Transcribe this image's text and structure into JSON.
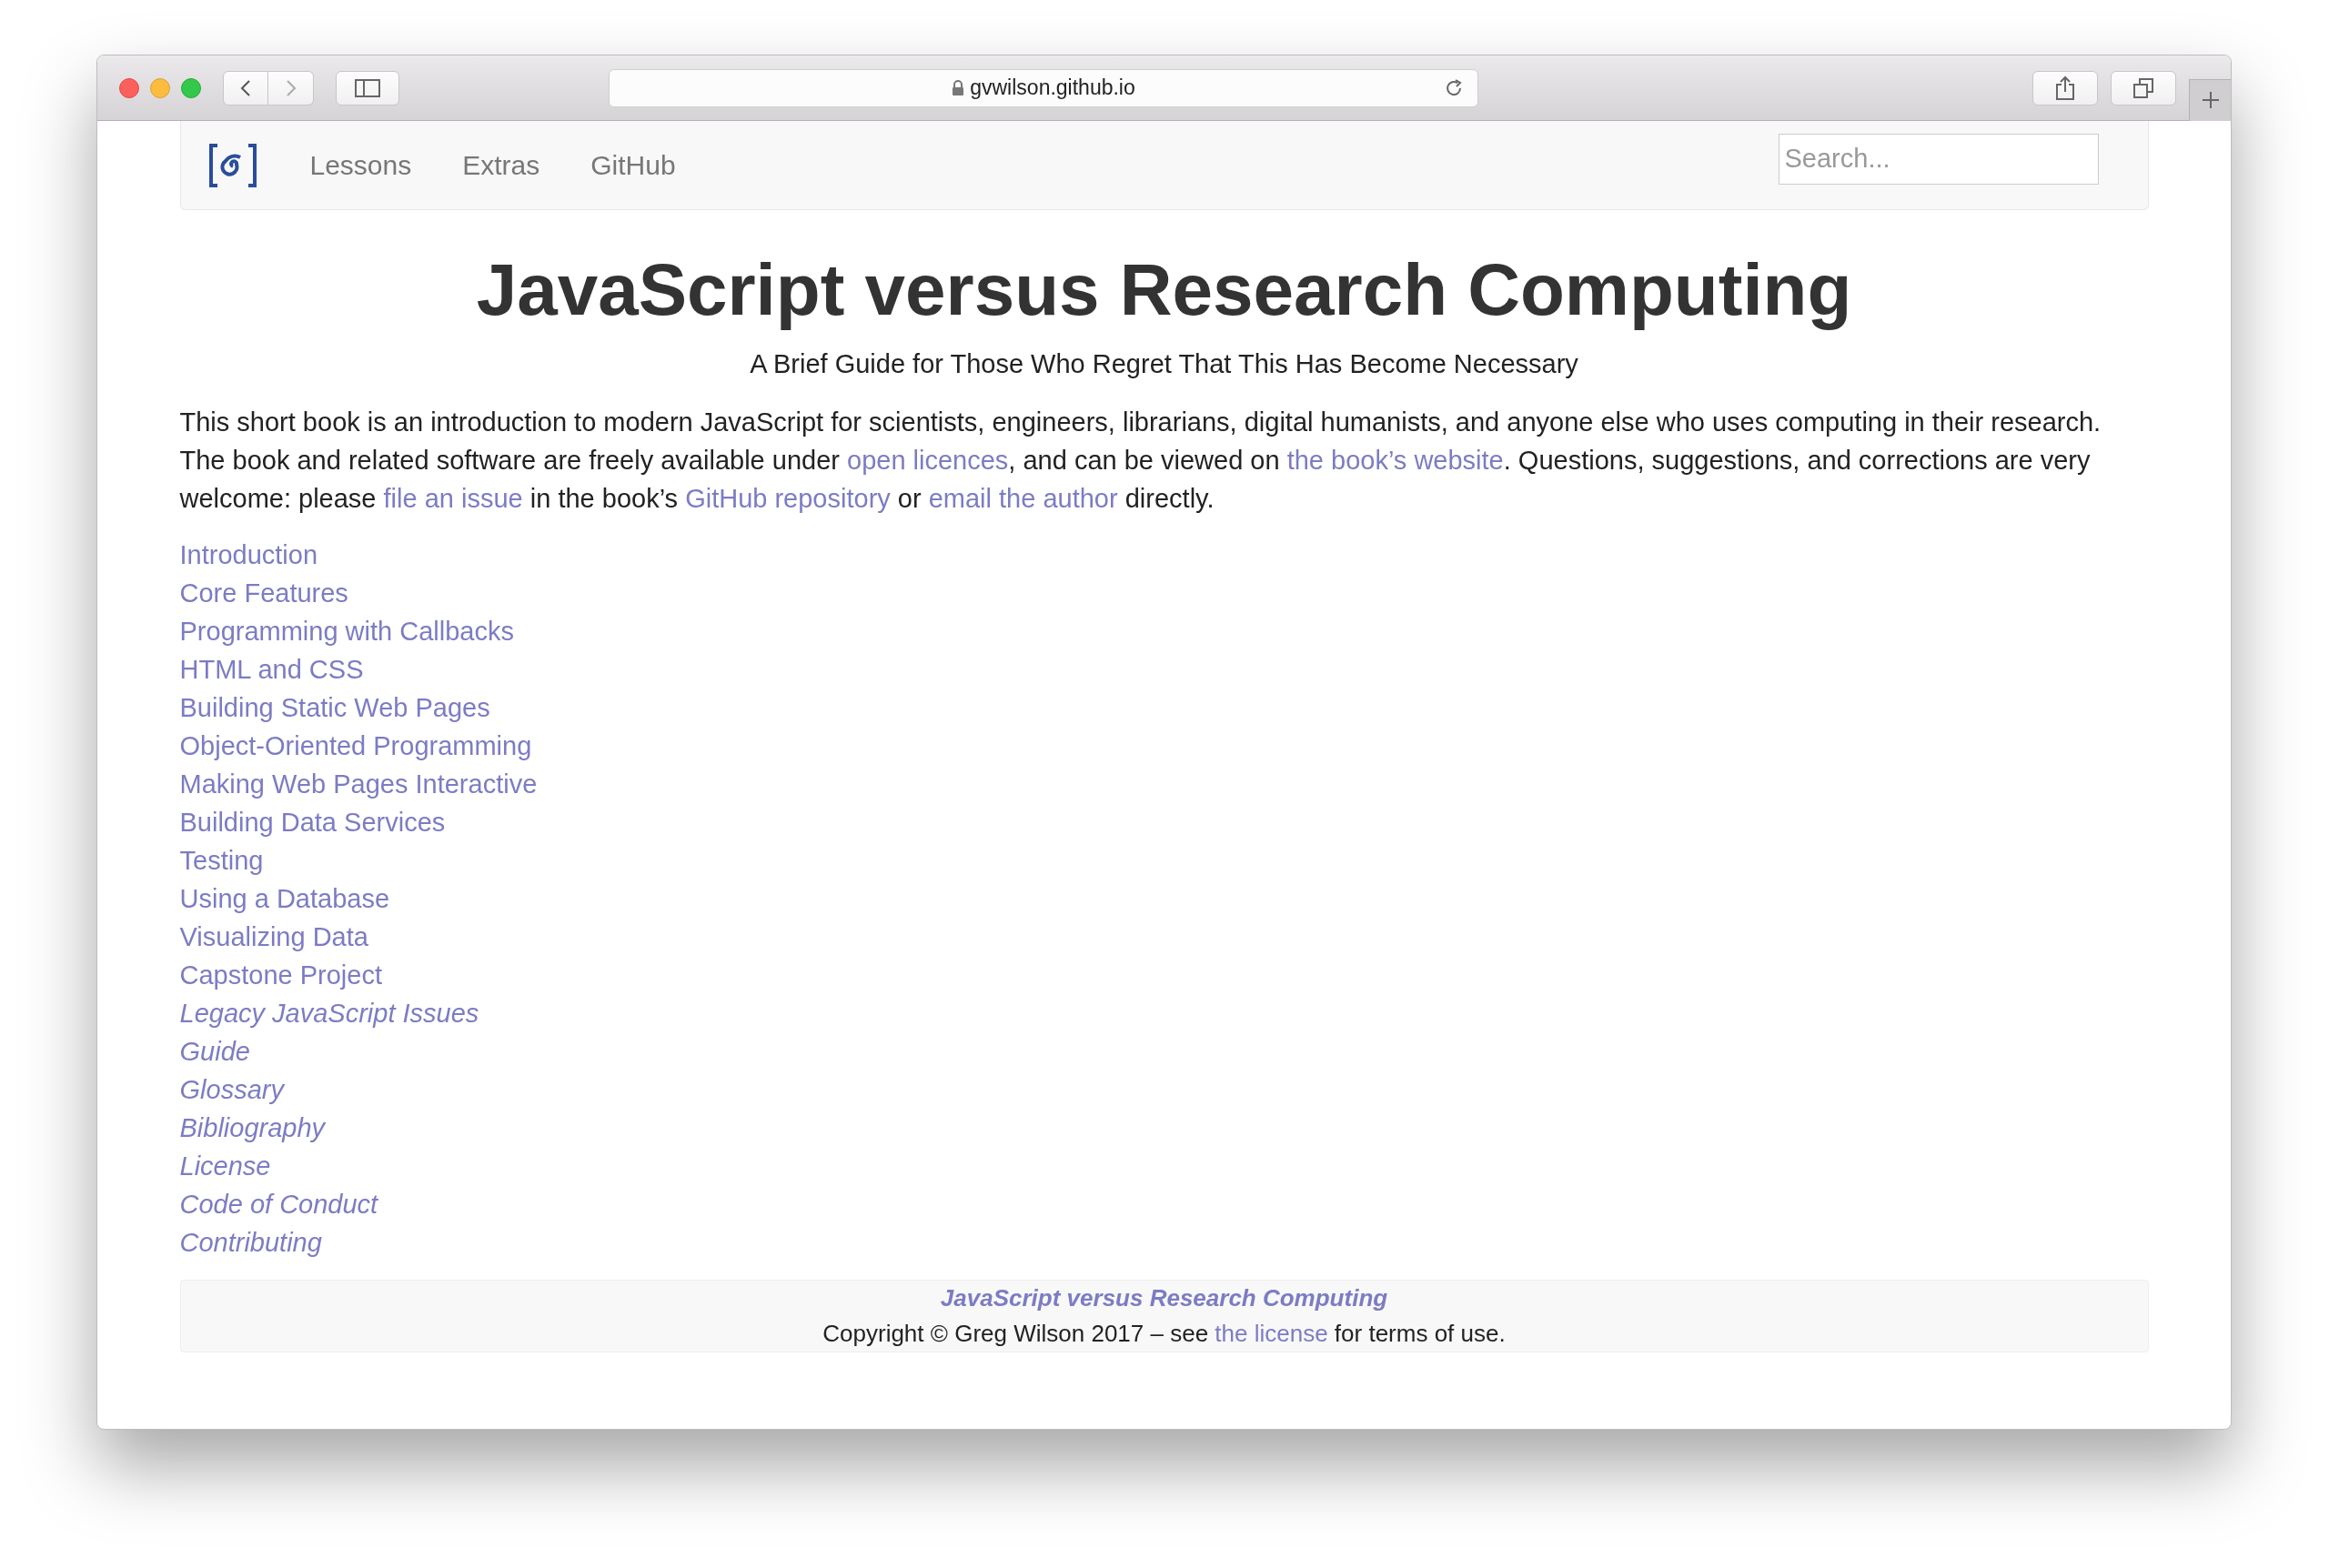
{
  "browser": {
    "url": "gvwilson.github.io"
  },
  "nav": {
    "items": [
      {
        "label": "Lessons"
      },
      {
        "label": "Extras"
      },
      {
        "label": "GitHub"
      }
    ],
    "search": {
      "placeholder": "Search..."
    }
  },
  "title": "JavaScript versus Research Computing",
  "subtitle": "A Brief Guide for Those Who Regret That This Has Become Necessary",
  "intro": [
    {
      "kind": "text",
      "text": "This short book is an introduction to modern JavaScript for scientists, engineers, librarians, digital humanists, and anyone else who uses computing in their research. The book and related software are freely available under "
    },
    {
      "kind": "link",
      "text": "open licences"
    },
    {
      "kind": "text",
      "text": ", and can be viewed on "
    },
    {
      "kind": "link",
      "text": "the book’s website"
    },
    {
      "kind": "text",
      "text": ". Questions, suggestions, and corrections are very welcome: please "
    },
    {
      "kind": "link",
      "text": "file an issue"
    },
    {
      "kind": "text",
      "text": " in the book’s "
    },
    {
      "kind": "link",
      "text": "GitHub repository"
    },
    {
      "kind": "text",
      "text": " or "
    },
    {
      "kind": "link",
      "text": "email the author"
    },
    {
      "kind": "text",
      "text": " directly."
    }
  ],
  "chapters": [
    {
      "label": "Introduction",
      "kind": "lesson"
    },
    {
      "label": "Core Features",
      "kind": "lesson"
    },
    {
      "label": "Programming with Callbacks",
      "kind": "lesson"
    },
    {
      "label": "HTML and CSS",
      "kind": "lesson"
    },
    {
      "label": "Building Static Web Pages",
      "kind": "lesson"
    },
    {
      "label": "Object-Oriented Programming",
      "kind": "lesson"
    },
    {
      "label": "Making Web Pages Interactive",
      "kind": "lesson"
    },
    {
      "label": "Building Data Services",
      "kind": "lesson"
    },
    {
      "label": "Testing",
      "kind": "lesson"
    },
    {
      "label": "Using a Database",
      "kind": "lesson"
    },
    {
      "label": "Visualizing Data",
      "kind": "lesson"
    },
    {
      "label": "Capstone Project",
      "kind": "lesson"
    },
    {
      "label": "Legacy JavaScript Issues",
      "kind": "extra"
    },
    {
      "label": "Guide",
      "kind": "extra"
    },
    {
      "label": "Glossary",
      "kind": "extra"
    },
    {
      "label": "Bibliography",
      "kind": "extra"
    },
    {
      "label": "License",
      "kind": "extra"
    },
    {
      "label": "Code of Conduct",
      "kind": "extra"
    },
    {
      "label": "Contributing",
      "kind": "extra"
    }
  ],
  "footer": {
    "title": "JavaScript versus Research Computing",
    "text_before": "Copyright © Greg Wilson 2017 – see ",
    "link": "the license",
    "text_after": " for terms of use."
  }
}
